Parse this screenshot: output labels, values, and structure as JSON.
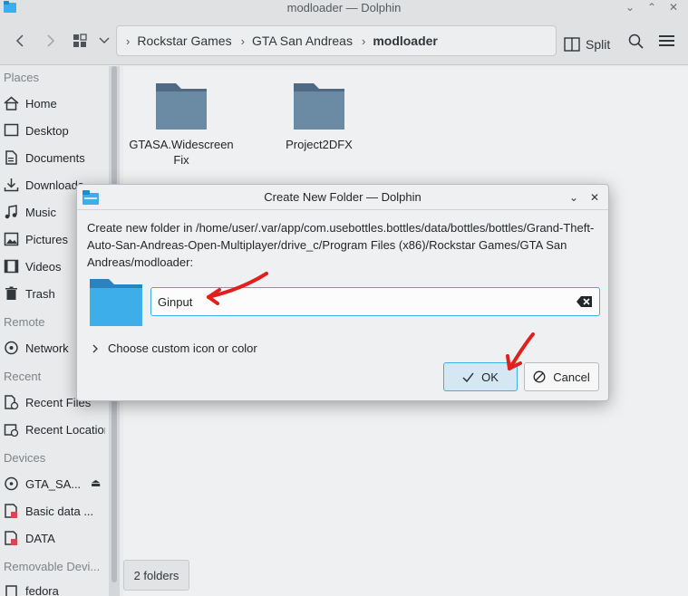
{
  "window": {
    "title": "modloader — Dolphin"
  },
  "breadcrumb": [
    "Rockstar Games",
    "GTA San Andreas",
    "modloader"
  ],
  "toolbar": {
    "split_label": "Split"
  },
  "sidebar": {
    "places_header": "Places",
    "places": [
      "Home",
      "Desktop",
      "Documents",
      "Downloads",
      "Music",
      "Pictures",
      "Videos",
      "Trash"
    ],
    "remote_header": "Remote",
    "remote": [
      "Network"
    ],
    "recent_header": "Recent",
    "recent": [
      "Recent Files",
      "Recent Locations"
    ],
    "devices_header": "Devices",
    "devices": [
      "GTA_SA...",
      "Basic data ...",
      "DATA"
    ],
    "removable_header": "Removable Devi...",
    "removable": [
      "fedora"
    ]
  },
  "content": {
    "folders": [
      {
        "name": "GTASA.Widescreen Fix"
      },
      {
        "name": "Project2DFX"
      }
    ],
    "status": "2 folders"
  },
  "dialog": {
    "title": "Create New Folder — Dolphin",
    "message": "Create new folder in /home/user/.var/app/com.usebottles.bottles/data/bottles/bottles/Grand-Theft-Auto-San-Andreas-Open-Multiplayer/drive_c/Program Files (x86)/Rockstar Games/GTA San Andreas/modloader:",
    "folder_name_value": "Ginput",
    "custom_icon_label": "Choose custom icon or color",
    "ok_label": "OK",
    "cancel_label": "Cancel"
  },
  "colors": {
    "accent": "#3daee9",
    "folder_dark": "#4f6a82",
    "folder_light": "#6b8aa4",
    "dialog_folder": "#3daee9",
    "annotation_arrow": "#e0201c"
  }
}
